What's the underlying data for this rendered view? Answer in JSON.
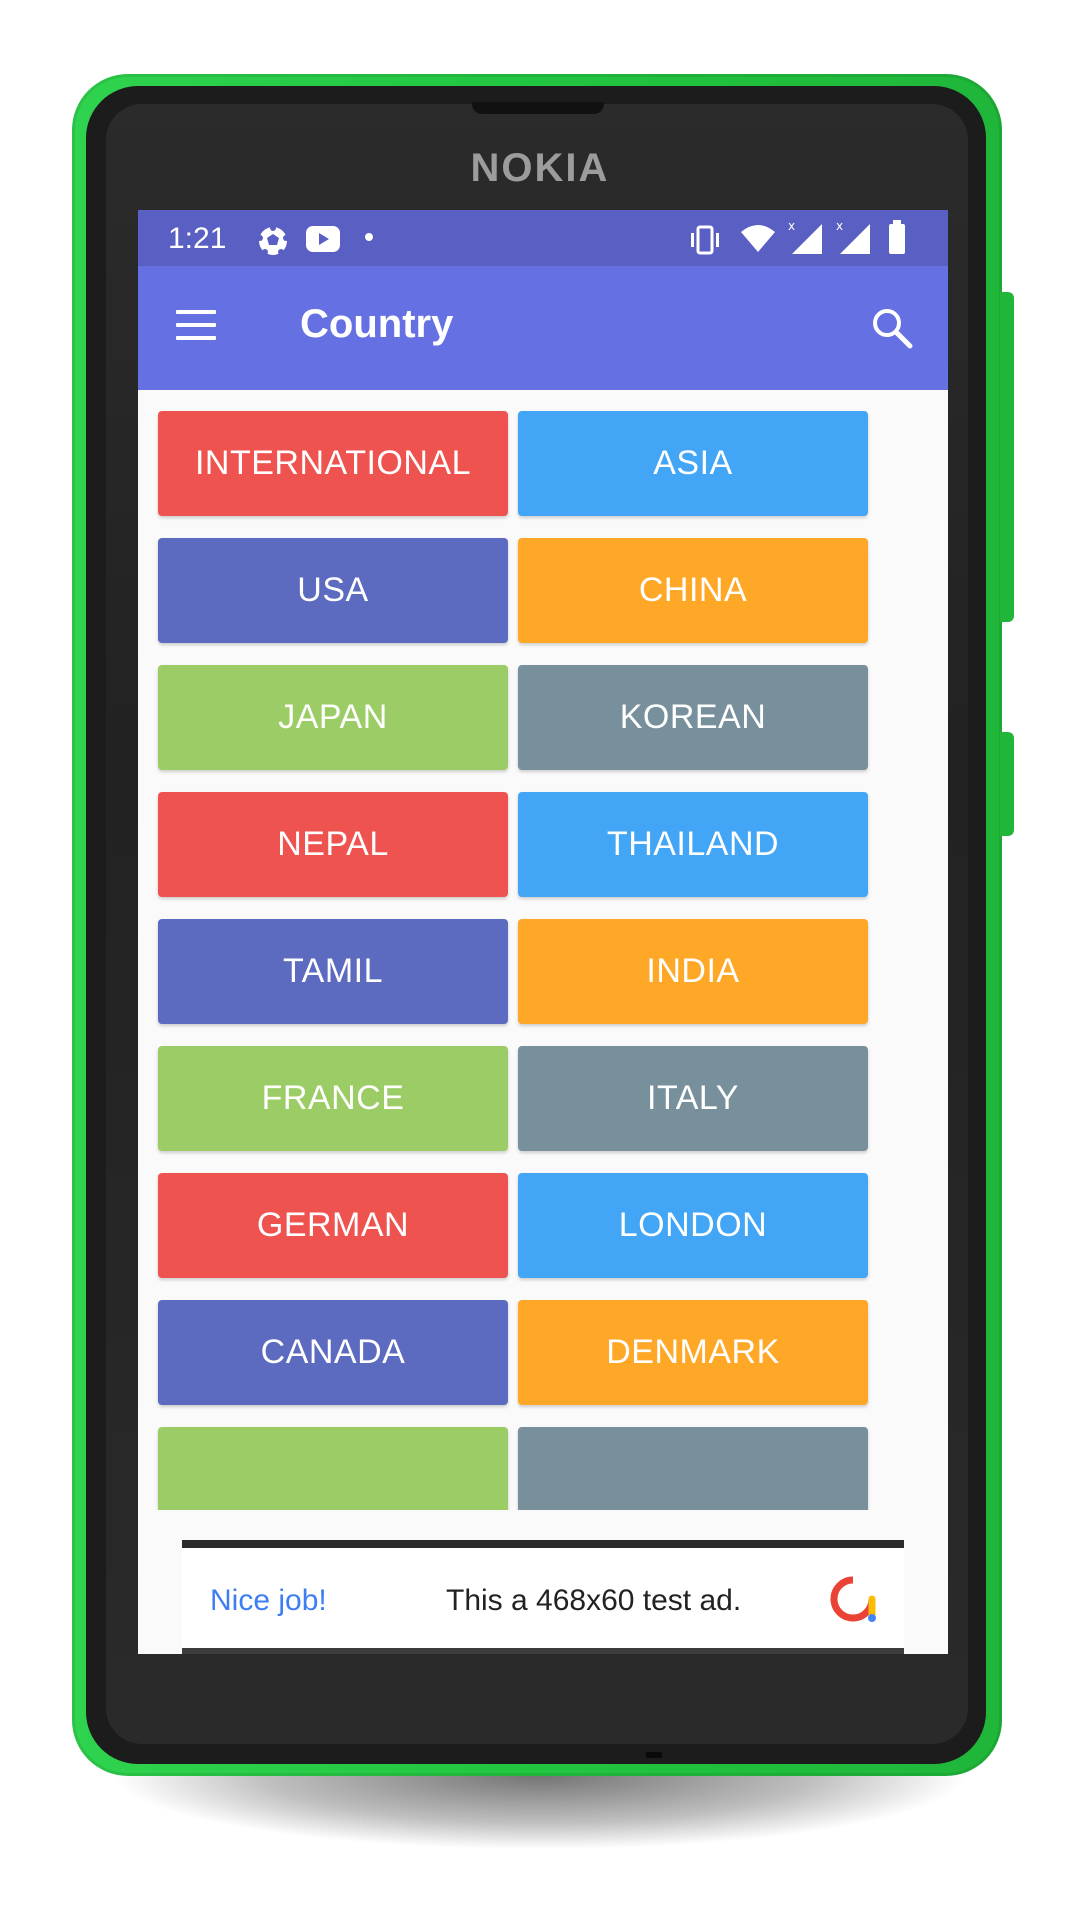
{
  "device": {
    "brand": "NOKIA"
  },
  "status_bar": {
    "time": "1:21",
    "left_icons": [
      "soccer-ball-icon",
      "youtube-icon",
      "dot-icon"
    ],
    "right_icons": [
      "vibrate-icon",
      "wifi-icon",
      "signal-icon",
      "signal-icon",
      "battery-icon"
    ]
  },
  "app_bar": {
    "title": "Country",
    "menu_icon": "hamburger-menu-icon",
    "search_icon": "search-icon"
  },
  "colors": {
    "status_bar": "#5a5fc4",
    "app_bar": "#6571e3",
    "red": "#ef5350",
    "blue": "#42a5f5",
    "indigo": "#5c6bc0",
    "orange": "#ffa726",
    "green": "#9ccc65",
    "grey": "#78909c"
  },
  "categories": [
    {
      "label": "INTERNATIONAL",
      "color": "#ef5350"
    },
    {
      "label": "ASIA",
      "color": "#42a5f5"
    },
    {
      "label": "USA",
      "color": "#5c6bc0"
    },
    {
      "label": "CHINA",
      "color": "#ffa726"
    },
    {
      "label": "JAPAN",
      "color": "#9ccc65"
    },
    {
      "label": "KOREAN",
      "color": "#78909c"
    },
    {
      "label": "NEPAL",
      "color": "#ef5350"
    },
    {
      "label": "THAILAND",
      "color": "#42a5f5"
    },
    {
      "label": "TAMIL",
      "color": "#5c6bc0"
    },
    {
      "label": "INDIA",
      "color": "#ffa726"
    },
    {
      "label": "FRANCE",
      "color": "#9ccc65"
    },
    {
      "label": "ITALY",
      "color": "#78909c"
    },
    {
      "label": "GERMAN",
      "color": "#ef5350"
    },
    {
      "label": "LONDON",
      "color": "#42a5f5"
    },
    {
      "label": "CANADA",
      "color": "#5c6bc0"
    },
    {
      "label": "DENMARK",
      "color": "#ffa726"
    },
    {
      "label": "",
      "color": "#9ccc65"
    },
    {
      "label": "",
      "color": "#78909c"
    }
  ],
  "ad": {
    "headline": "Nice job!",
    "text": "This a 468x60 test ad.",
    "logo_icon": "google-ads-icon"
  }
}
